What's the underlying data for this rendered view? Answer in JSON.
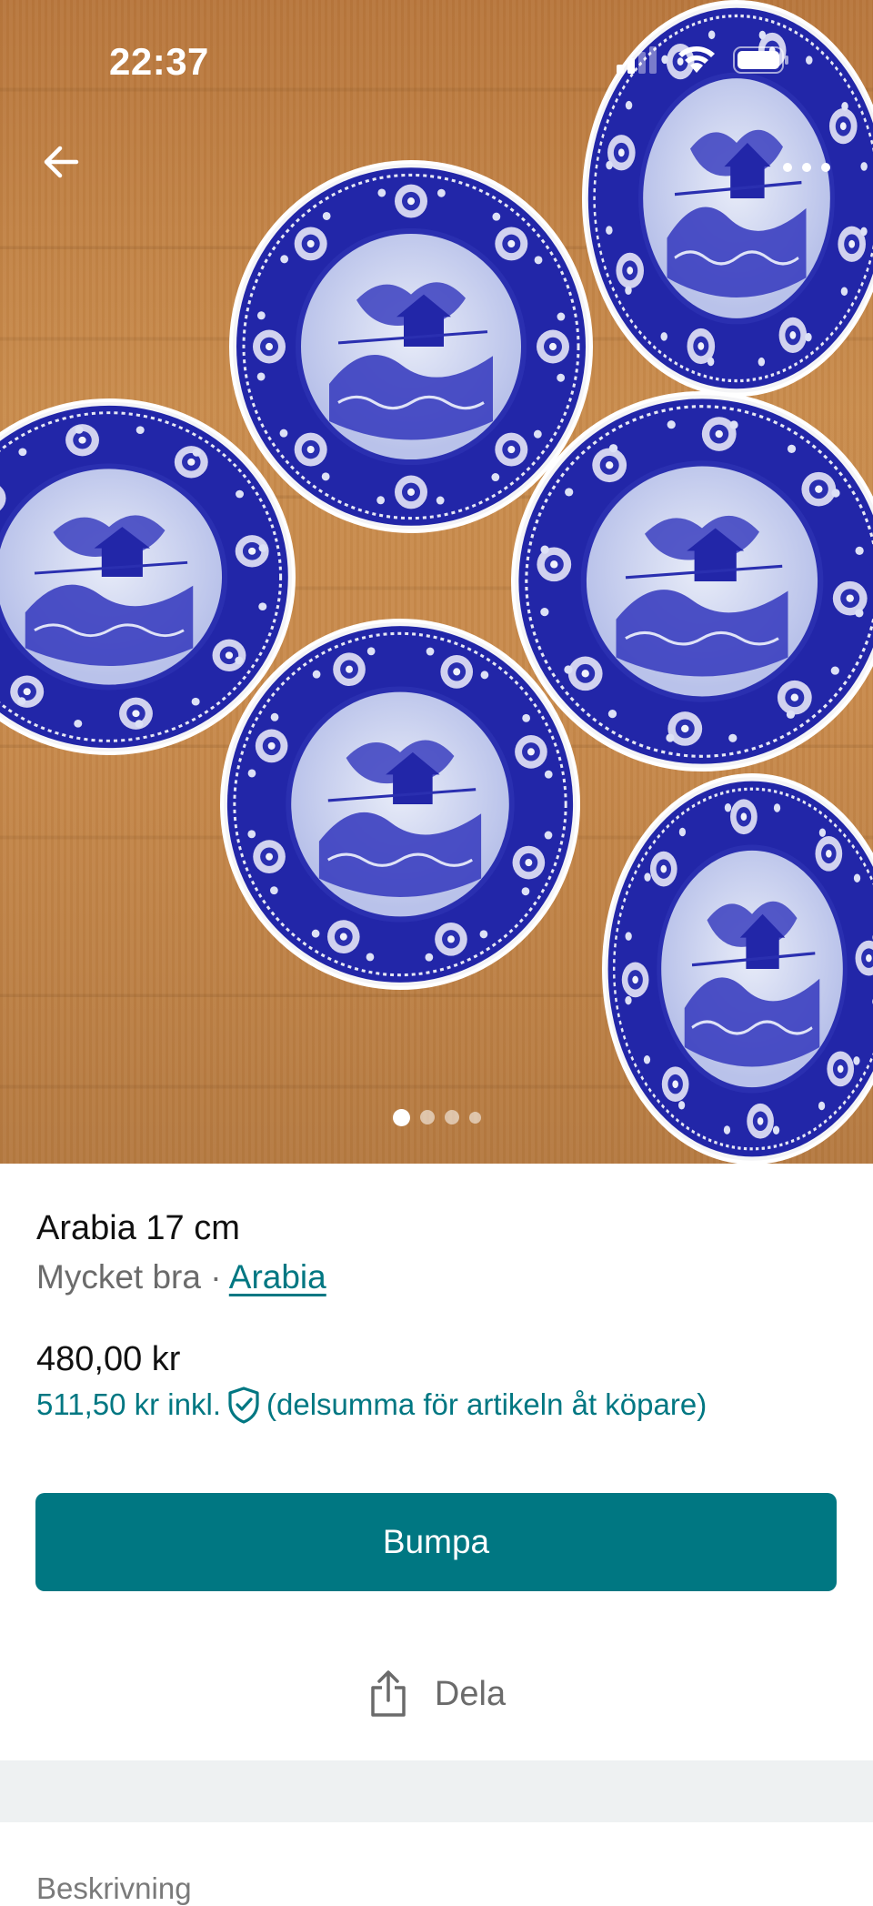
{
  "status_bar": {
    "time": "22:37"
  },
  "photo": {
    "carousel_total": 4,
    "carousel_active": 1
  },
  "item": {
    "title": "Arabia 17 cm",
    "condition": "Mycket bra",
    "separator": " · ",
    "brand": "Arabia",
    "price": "480,00 kr",
    "price_incl": "511,50 kr inkl.",
    "price_incl_note": "(delsumma för artikeln åt köpare)"
  },
  "actions": {
    "bump_label": "Bumpa",
    "share_label": "Dela"
  },
  "description": {
    "label": "Beskrivning"
  },
  "colors": {
    "accent": "#007782",
    "plate_blue": "#2a2fb0",
    "wood": "#c88a4c"
  },
  "icons": [
    "back-arrow-icon",
    "more-dots-icon",
    "share-icon",
    "shield-check-icon",
    "signal-icon",
    "wifi-icon",
    "battery-icon"
  ]
}
